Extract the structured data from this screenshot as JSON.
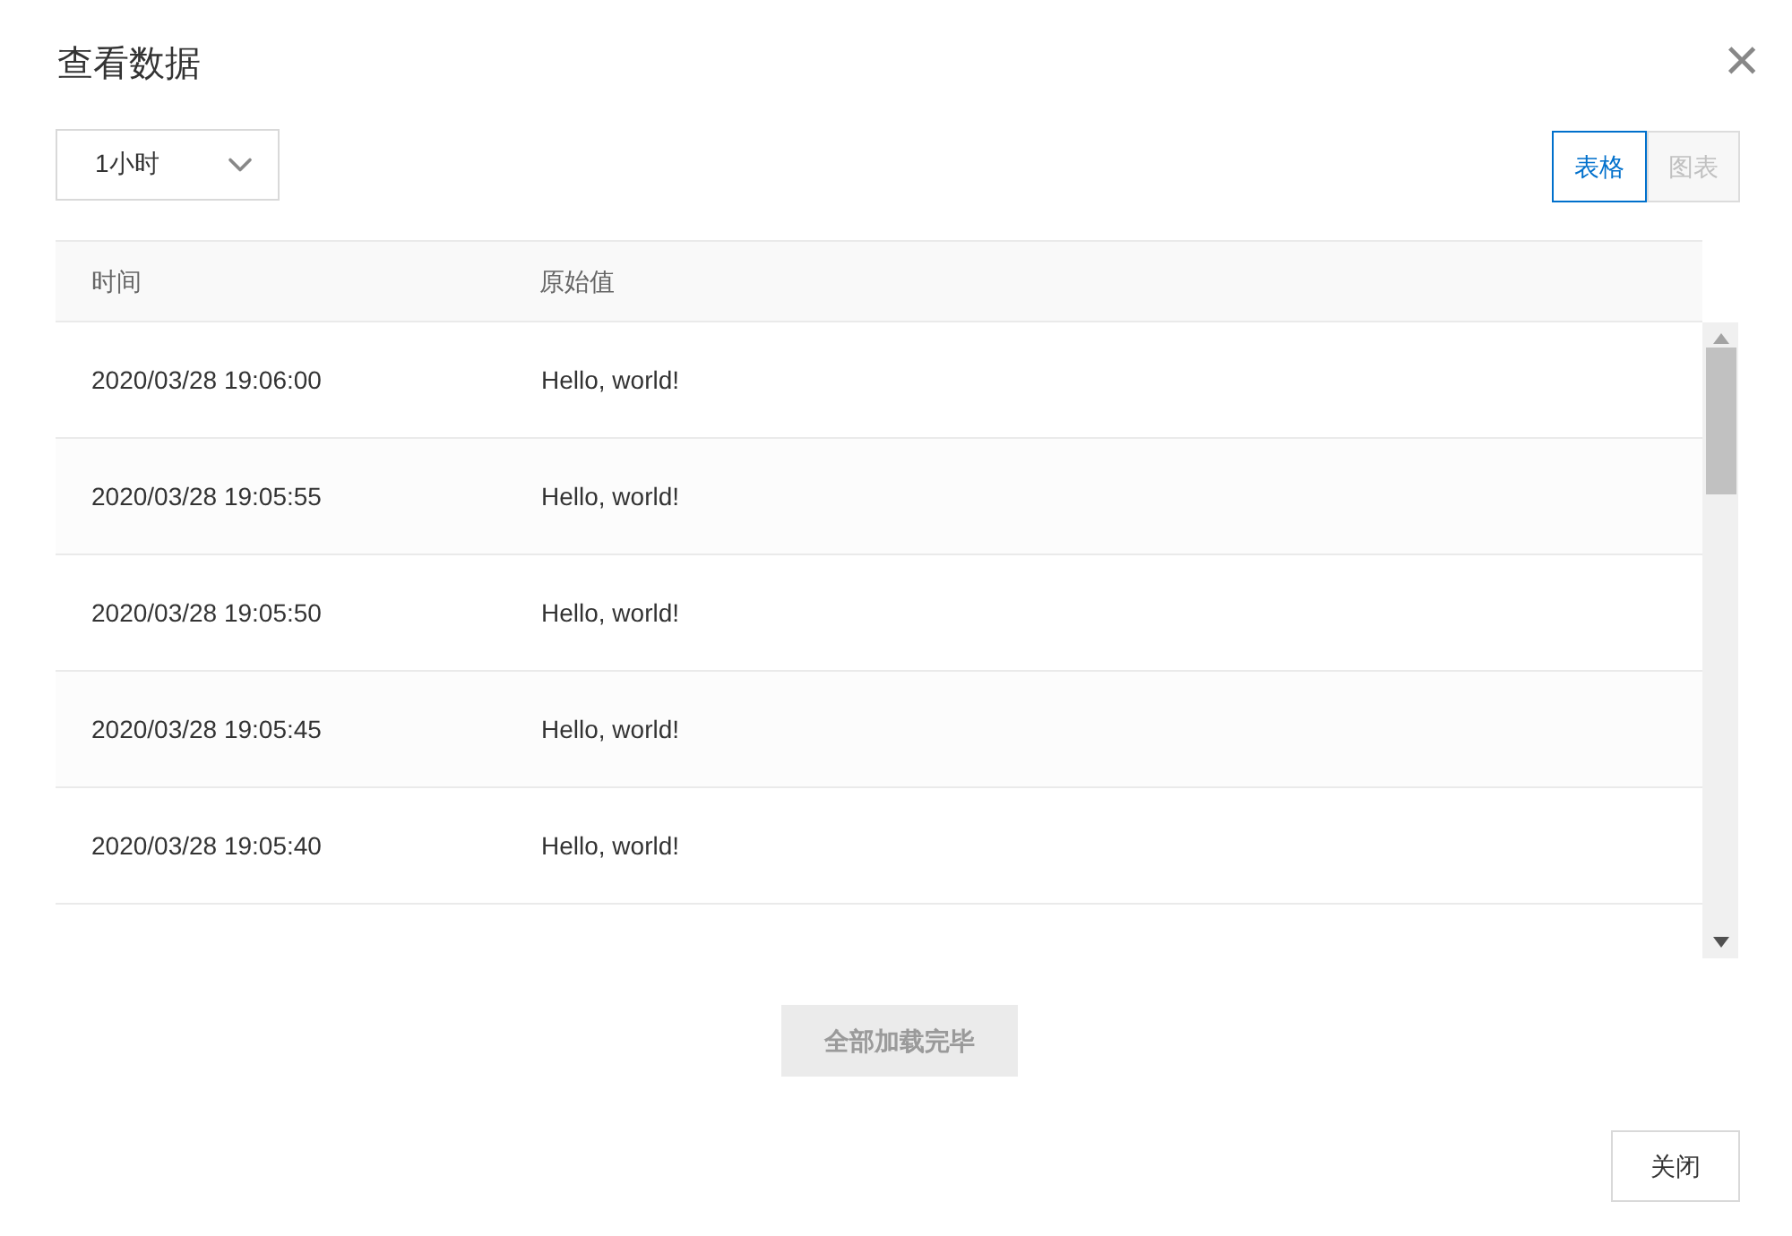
{
  "dialog": {
    "title": "查看数据",
    "close": "×"
  },
  "range_select": {
    "value": "1小时"
  },
  "view_tabs": [
    {
      "label": "表格",
      "selected": true
    },
    {
      "label": "图表",
      "selected": false
    }
  ],
  "table": {
    "columns": [
      "时间",
      "原始值"
    ],
    "rows": [
      [
        "2020/03/28 19:06:00",
        "Hello, world!"
      ],
      [
        "2020/03/28 19:05:55",
        "Hello, world!"
      ],
      [
        "2020/03/28 19:05:50",
        "Hello, world!"
      ],
      [
        "2020/03/28 19:05:45",
        "Hello, world!"
      ],
      [
        "2020/03/28 19:05:40",
        "Hello, world!"
      ]
    ]
  },
  "load_more": {
    "label": "全部加载完毕",
    "disabled": true
  },
  "footer_buttons": [
    "关闭"
  ]
}
